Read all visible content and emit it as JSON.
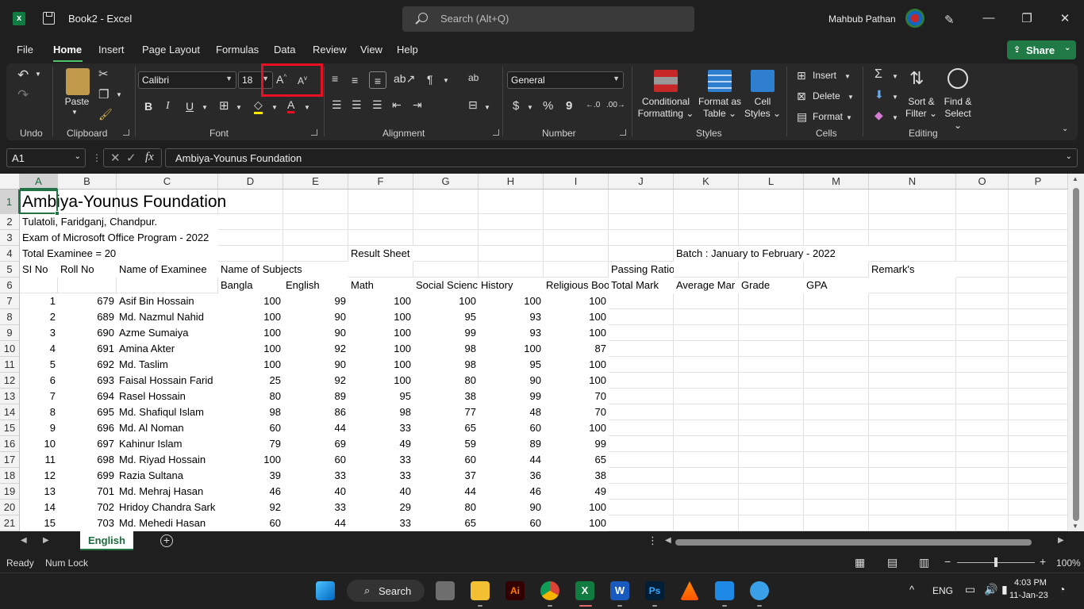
{
  "titlebar": {
    "doc_title": "Book2  -  Excel",
    "search_placeholder": "Search (Alt+Q)",
    "user_name": "Mahbub Pathan"
  },
  "menu": {
    "items": [
      "File",
      "Home",
      "Insert",
      "Page Layout",
      "Formulas",
      "Data",
      "Review",
      "View",
      "Help"
    ],
    "active": "Home",
    "share_label": "Share"
  },
  "ribbon": {
    "groups": {
      "undo": "Undo",
      "clipboard": "Clipboard",
      "font": "Font",
      "alignment": "Alignment",
      "number": "Number",
      "styles": "Styles",
      "cells": "Cells",
      "editing": "Editing"
    },
    "paste_label": "Paste",
    "font_name": "Calibri",
    "font_size": "18",
    "bold": "B",
    "italic": "I",
    "underline": "U",
    "number_format": "General",
    "currency": "$",
    "percent": "%",
    "comma": "9",
    "conditional_formatting": [
      "Conditional",
      "Formatting"
    ],
    "format_as_table": [
      "Format as",
      "Table"
    ],
    "cell_styles": [
      "Cell",
      "Styles"
    ],
    "insert": "Insert",
    "delete": "Delete",
    "format": "Format",
    "sort_filter": [
      "Sort &",
      "Filter"
    ],
    "find_select": [
      "Find &",
      "Select"
    ]
  },
  "formula_bar": {
    "name_box": "A1",
    "formula": "Ambiya-Younus Foundation"
  },
  "sheet": {
    "columns": [
      "A",
      "B",
      "C",
      "D",
      "E",
      "F",
      "G",
      "H",
      "I",
      "J",
      "K",
      "L",
      "M",
      "N",
      "O",
      "P"
    ],
    "rows": [
      "1",
      "2",
      "3",
      "4",
      "5",
      "6",
      "7",
      "8",
      "9",
      "10",
      "11",
      "12",
      "13",
      "14",
      "15",
      "16",
      "17",
      "18",
      "19",
      "20",
      "21"
    ],
    "title": "Ambiya-Younus Foundation",
    "address": "Tulatoli, Faridganj, Chandpur.",
    "exam": "Exam of Microsoft Office Program - 2022",
    "total_examinee": "Total Examinee = 20",
    "result_sheet": "Result Sheet",
    "batch": "Batch : January to February - 2022",
    "headers5": {
      "si_no": "SI No",
      "roll_no": "Roll No",
      "name": "Name of Examinee",
      "subjects": "Name of Subjects",
      "passing_ratio": "Passing Ratio",
      "remarks": "Remark's"
    },
    "headers6": [
      "Bangla",
      "English",
      "Math",
      "Social Scienc",
      "History",
      "Religious Boo",
      "Total Mark",
      "Average Mar",
      "Grade",
      "GPA"
    ],
    "data_rows": [
      [
        "1",
        "679",
        "Asif Bin Hossain",
        "100",
        "99",
        "100",
        "100",
        "100",
        "100"
      ],
      [
        "2",
        "689",
        "Md. Nazmul Nahid",
        "100",
        "90",
        "100",
        "95",
        "93",
        "100"
      ],
      [
        "3",
        "690",
        "Azme Sumaiya",
        "100",
        "90",
        "100",
        "99",
        "93",
        "100"
      ],
      [
        "4",
        "691",
        "Amina Akter",
        "100",
        "92",
        "100",
        "98",
        "100",
        "87"
      ],
      [
        "5",
        "692",
        "Md. Taslim",
        "100",
        "90",
        "100",
        "98",
        "95",
        "100"
      ],
      [
        "6",
        "693",
        "Faisal Hossain Farid",
        "25",
        "92",
        "100",
        "80",
        "90",
        "100"
      ],
      [
        "7",
        "694",
        "Rasel Hossain",
        "80",
        "89",
        "95",
        "38",
        "99",
        "70"
      ],
      [
        "8",
        "695",
        "Md. Shafiqul Islam",
        "98",
        "86",
        "98",
        "77",
        "48",
        "70"
      ],
      [
        "9",
        "696",
        "Md. Al Noman",
        "60",
        "44",
        "33",
        "65",
        "60",
        "100"
      ],
      [
        "10",
        "697",
        "Kahinur Islam",
        "79",
        "69",
        "49",
        "59",
        "89",
        "99"
      ],
      [
        "11",
        "698",
        "Md. Riyad Hossain",
        "100",
        "60",
        "33",
        "60",
        "44",
        "65"
      ],
      [
        "12",
        "699",
        "Razia Sultana",
        "39",
        "33",
        "33",
        "37",
        "36",
        "38"
      ],
      [
        "13",
        "701",
        "Md. Mehraj Hasan",
        "46",
        "40",
        "40",
        "44",
        "46",
        "49"
      ],
      [
        "14",
        "702",
        "Hridoy Chandra Sark",
        "92",
        "33",
        "29",
        "80",
        "90",
        "100"
      ],
      [
        "15",
        "703",
        "Md. Mehedi Hasan",
        "60",
        "44",
        "33",
        "65",
        "60",
        "100"
      ]
    ],
    "tab_name": "English"
  },
  "status": {
    "ready": "Ready",
    "num_lock": "Num Lock",
    "zoom": "100%"
  },
  "taskbar": {
    "search_label": "Search",
    "language": "ENG",
    "time": "4:03 PM",
    "date": "11-Jan-23"
  },
  "colors": {
    "excel_green": "#217346",
    "highlight_box": "#e81123",
    "share_green": "#1f7a45"
  }
}
